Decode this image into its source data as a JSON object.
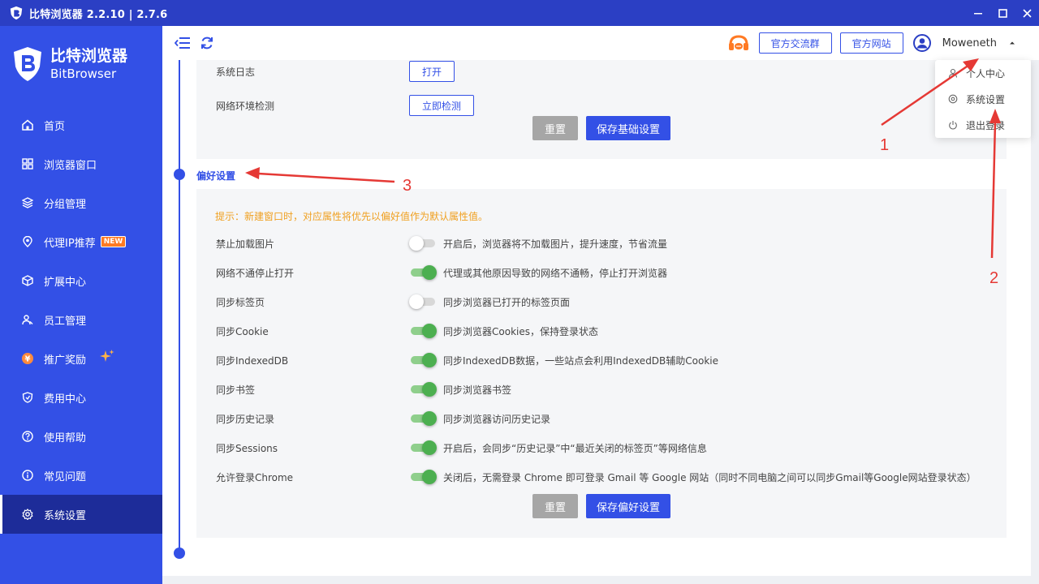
{
  "window": {
    "title": "比特浏览器 2.2.10 | 2.7.6"
  },
  "brand": {
    "name_cn": "比特浏览器",
    "name_en": "BitBrowser"
  },
  "sidebar": {
    "items": [
      {
        "label": "首页",
        "icon": "home-icon"
      },
      {
        "label": "浏览器窗口",
        "icon": "grid-icon"
      },
      {
        "label": "分组管理",
        "icon": "layers-icon"
      },
      {
        "label": "代理IP推荐",
        "icon": "location-icon",
        "badge": "NEW"
      },
      {
        "label": "扩展中心",
        "icon": "cube-icon"
      },
      {
        "label": "员工管理",
        "icon": "users-icon"
      },
      {
        "label": "推广奖励",
        "icon": "reward-icon"
      },
      {
        "label": "费用中心",
        "icon": "shield-icon"
      },
      {
        "label": "使用帮助",
        "icon": "help-icon"
      },
      {
        "label": "常见问题",
        "icon": "info-icon"
      },
      {
        "label": "系统设置",
        "icon": "gear-icon",
        "active": true
      }
    ]
  },
  "header": {
    "official_group": "官方交流群",
    "official_site": "官方网站",
    "username": "Moweneth"
  },
  "user_menu": {
    "items": [
      {
        "label": "个人中心",
        "icon": "user-icon"
      },
      {
        "label": "系统设置",
        "icon": "settings-icon"
      },
      {
        "label": "退出登录",
        "icon": "power-icon"
      }
    ]
  },
  "basic": {
    "system_log_label": "系统日志",
    "open_button": "打开",
    "network_check_label": "网络环境检测",
    "check_now_button": "立即检测",
    "reset_button": "重置",
    "save_button": "保存基础设置"
  },
  "preferences": {
    "title": "偏好设置",
    "hint": "提示：新建窗口时，对应属性将优先以偏好值作为默认属性值。",
    "rows": [
      {
        "label": "禁止加载图片",
        "on": false,
        "desc": "开启后，浏览器将不加载图片，提升速度，节省流量"
      },
      {
        "label": "网络不通停止打开",
        "on": true,
        "desc": "代理或其他原因导致的网络不通畅，停止打开浏览器"
      },
      {
        "label": "同步标签页",
        "on": false,
        "desc": "同步浏览器已打开的标签页面"
      },
      {
        "label": "同步Cookie",
        "on": true,
        "desc": "同步浏览器Cookies，保持登录状态"
      },
      {
        "label": "同步IndexedDB",
        "on": true,
        "desc": "同步IndexedDB数据，一些站点会利用IndexedDB辅助Cookie"
      },
      {
        "label": "同步书签",
        "on": true,
        "desc": "同步浏览器书签"
      },
      {
        "label": "同步历史记录",
        "on": true,
        "desc": "同步浏览器访问历史记录"
      },
      {
        "label": "同步Sessions",
        "on": true,
        "desc": "开启后，会同步“历史记录”中“最近关闭的标签页”等网络信息"
      },
      {
        "label": "允许登录Chrome",
        "on": true,
        "desc": "关闭后，无需登录 Chrome 即可登录 Gmail 等 Google 网站（同时不同电脑之间可以同步Gmail等Google网站登录状态）"
      }
    ],
    "reset_button": "重置",
    "save_button": "保存偏好设置"
  },
  "annotations": [
    "1",
    "2",
    "3"
  ],
  "colors": {
    "primary": "#3350e6",
    "titlebar": "#2b3fc4",
    "sidebar_active": "#1d2c99",
    "hint": "#f0a020",
    "toggle_on": "#4caf50",
    "annotation": "#e53935"
  }
}
